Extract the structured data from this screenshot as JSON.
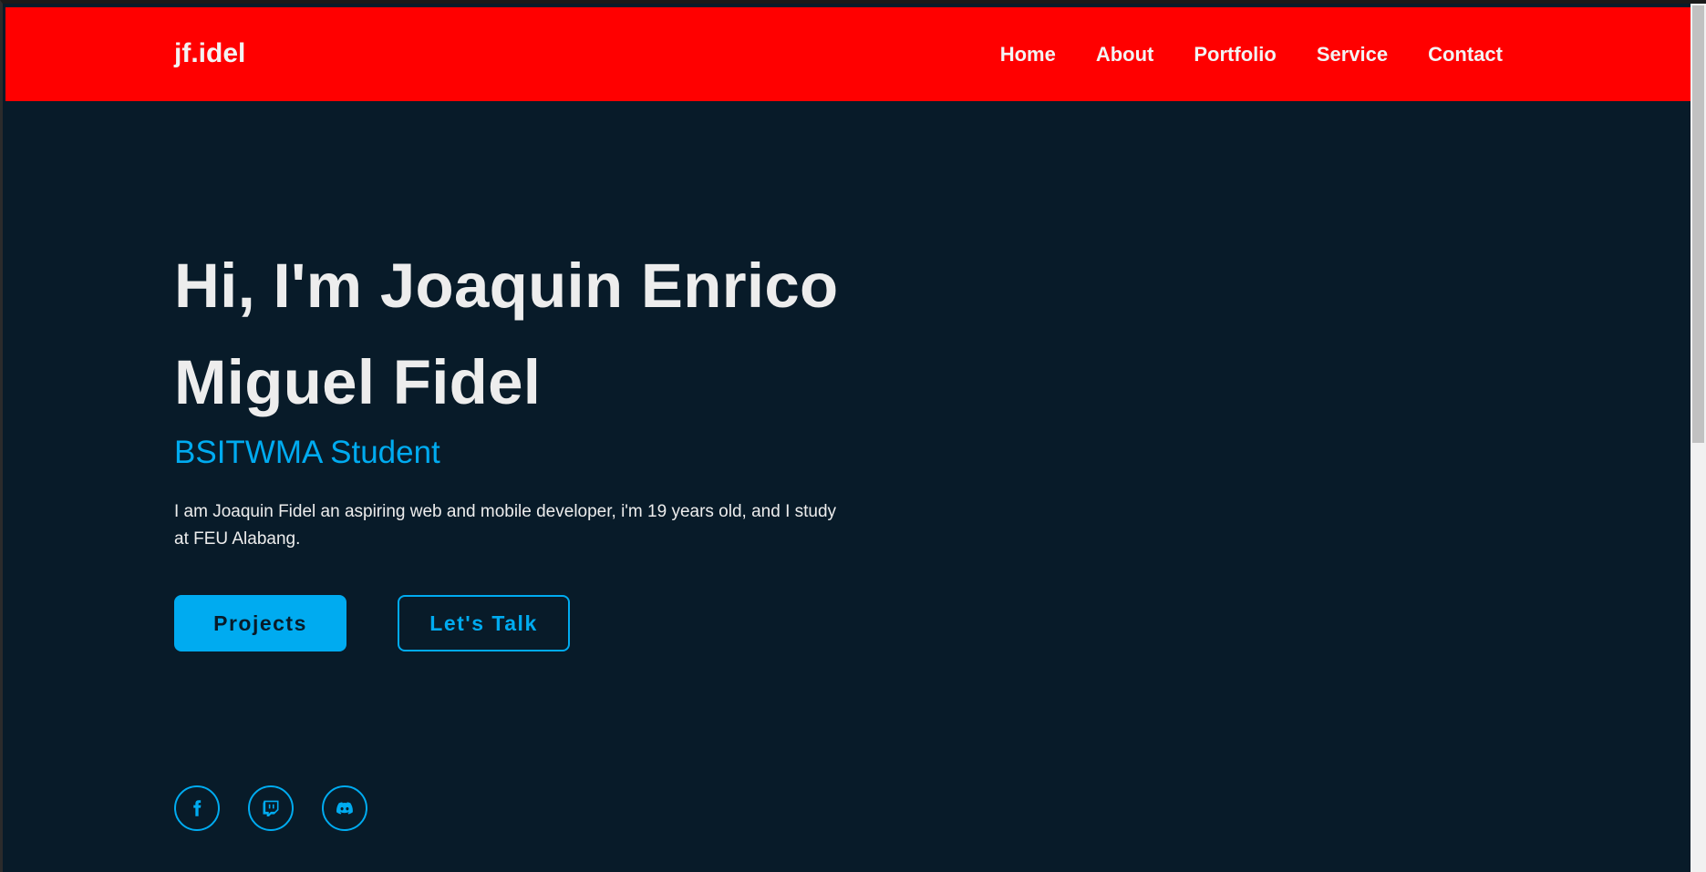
{
  "header": {
    "logo": "jf.idel",
    "nav": [
      "Home",
      "About",
      "Portfolio",
      "Service",
      "Contact"
    ]
  },
  "hero": {
    "heading_line1": "Hi, I'm Joaquin Enrico",
    "heading_line2": "Miguel Fidel",
    "subtitle": "BSITWMA Student",
    "description": "I am Joaquin Fidel an aspiring web and mobile developer, i'm 19 years old, and I study at FEU Alabang."
  },
  "buttons": {
    "primary": "Projects",
    "secondary": "Let's Talk"
  },
  "socials": [
    "facebook-icon",
    "twitch-icon",
    "discord-icon"
  ],
  "colors": {
    "header_bg": "#ff0000",
    "page_bg": "#081b29",
    "accent": "#00abf0",
    "text": "#ededed"
  }
}
